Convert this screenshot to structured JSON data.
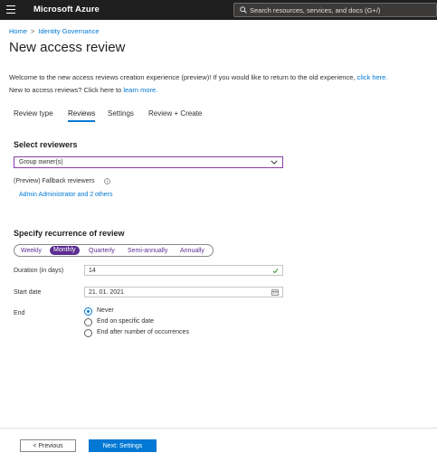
{
  "topbar": {
    "brand": "Microsoft Azure",
    "search_placeholder": "Search resources, services, and docs (G+/)"
  },
  "breadcrumb": {
    "home": "Home",
    "separator": ">",
    "current": "Identity Governance"
  },
  "page_title": "New access review",
  "intro": {
    "line1": "Welcome to the new access reviews creation experience (preview)! If you would like to return to the old experience,",
    "line1_link": "click here.",
    "line2": "New to access reviews? Click here to",
    "line2_link": "learn more."
  },
  "tabs": [
    {
      "label": "Review type",
      "active": false
    },
    {
      "label": "Reviews",
      "active": true
    },
    {
      "label": "Settings",
      "active": false
    },
    {
      "label": "Review + Create",
      "active": false
    }
  ],
  "select_reviewers": {
    "title": "Select reviewers",
    "dropdown_value": "Group owner(s)",
    "fallback_label": "(Preview) Fallback reviewers",
    "fallback_link": "Admin Administrator and 2 others"
  },
  "recurrence": {
    "title": "Specify recurrence of review",
    "options": [
      "Weekly",
      "Monthly",
      "Quarterly",
      "Semi-annually",
      "Annually"
    ],
    "selected": "Monthly",
    "duration_label": "Duration (in days)",
    "duration_value": "14",
    "start_label": "Start date",
    "start_value": "21. 01. 2021",
    "end_label": "End",
    "end_options": [
      "Never",
      "End on specific date",
      "End after number of occurrences"
    ],
    "end_selected": "Never"
  },
  "footer": {
    "prev_label": "< Previous",
    "next_label": "Next: Settings"
  },
  "colors": {
    "topbar_bg": "#1f1f1f",
    "accent_blue": "#0078d4",
    "pill_purple": "#5c2d91",
    "dropdown_border": "#8a3fa8",
    "valid_green": "#107c10"
  },
  "icons": [
    "hamburger-icon",
    "search-icon",
    "chevron-down-icon",
    "info-icon",
    "check-icon",
    "calendar-icon"
  ]
}
